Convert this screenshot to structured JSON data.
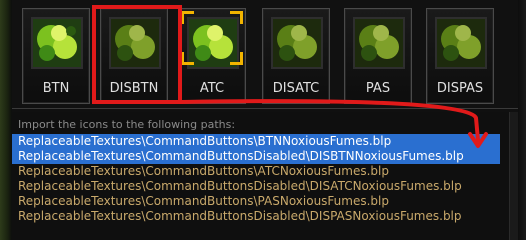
{
  "slots": [
    {
      "label": "BTN",
      "variant": "normal"
    },
    {
      "label": "DISBTN",
      "variant": "disabled"
    },
    {
      "label": "ATC",
      "variant": "autocast"
    },
    {
      "label": "DISATC",
      "variant": "disabled"
    },
    {
      "label": "PAS",
      "variant": "disabled"
    },
    {
      "label": "DISPAS",
      "variant": "disabled"
    }
  ],
  "import": {
    "header": "Import the icons to the following paths:",
    "paths": [
      "ReplaceableTextures\\CommandButtons\\BTNNoxiousFumes.blp",
      "ReplaceableTextures\\CommandButtonsDisabled\\DISBTNNoxiousFumes.blp",
      "ReplaceableTextures\\CommandButtons\\ATCNoxiousFumes.blp",
      "ReplaceableTextures\\CommandButtonsDisabled\\DISATCNoxiousFumes.blp",
      "ReplaceableTextures\\CommandButtons\\PASNoxiousFumes.blp",
      "ReplaceableTextures\\CommandButtonsDisabled\\DISPASNoxiousFumes.blp"
    ],
    "selected": [
      0,
      1
    ]
  },
  "colors": {
    "highlight": "#e11a1a",
    "selection": "#2a6fd0",
    "path_text": "#c9a96b",
    "autocast_bracket": "#f2b400"
  },
  "icons": {
    "normal": "noxious-fumes-icon",
    "disabled": "noxious-fumes-disabled-icon",
    "autocast": "noxious-fumes-autocast-icon"
  }
}
